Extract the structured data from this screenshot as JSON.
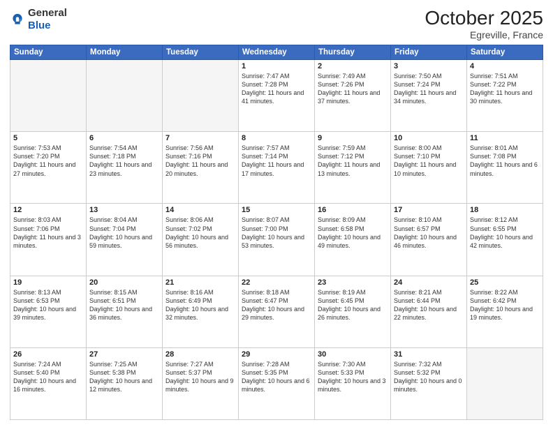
{
  "header": {
    "logo_general": "General",
    "logo_blue": "Blue",
    "month_title": "October 2025",
    "location": "Egreville, France"
  },
  "weekdays": [
    "Sunday",
    "Monday",
    "Tuesday",
    "Wednesday",
    "Thursday",
    "Friday",
    "Saturday"
  ],
  "weeks": [
    [
      {
        "day": "",
        "info": ""
      },
      {
        "day": "",
        "info": ""
      },
      {
        "day": "",
        "info": ""
      },
      {
        "day": "1",
        "info": "Sunrise: 7:47 AM\nSunset: 7:28 PM\nDaylight: 11 hours and 41 minutes."
      },
      {
        "day": "2",
        "info": "Sunrise: 7:49 AM\nSunset: 7:26 PM\nDaylight: 11 hours and 37 minutes."
      },
      {
        "day": "3",
        "info": "Sunrise: 7:50 AM\nSunset: 7:24 PM\nDaylight: 11 hours and 34 minutes."
      },
      {
        "day": "4",
        "info": "Sunrise: 7:51 AM\nSunset: 7:22 PM\nDaylight: 11 hours and 30 minutes."
      }
    ],
    [
      {
        "day": "5",
        "info": "Sunrise: 7:53 AM\nSunset: 7:20 PM\nDaylight: 11 hours and 27 minutes."
      },
      {
        "day": "6",
        "info": "Sunrise: 7:54 AM\nSunset: 7:18 PM\nDaylight: 11 hours and 23 minutes."
      },
      {
        "day": "7",
        "info": "Sunrise: 7:56 AM\nSunset: 7:16 PM\nDaylight: 11 hours and 20 minutes."
      },
      {
        "day": "8",
        "info": "Sunrise: 7:57 AM\nSunset: 7:14 PM\nDaylight: 11 hours and 17 minutes."
      },
      {
        "day": "9",
        "info": "Sunrise: 7:59 AM\nSunset: 7:12 PM\nDaylight: 11 hours and 13 minutes."
      },
      {
        "day": "10",
        "info": "Sunrise: 8:00 AM\nSunset: 7:10 PM\nDaylight: 11 hours and 10 minutes."
      },
      {
        "day": "11",
        "info": "Sunrise: 8:01 AM\nSunset: 7:08 PM\nDaylight: 11 hours and 6 minutes."
      }
    ],
    [
      {
        "day": "12",
        "info": "Sunrise: 8:03 AM\nSunset: 7:06 PM\nDaylight: 11 hours and 3 minutes."
      },
      {
        "day": "13",
        "info": "Sunrise: 8:04 AM\nSunset: 7:04 PM\nDaylight: 10 hours and 59 minutes."
      },
      {
        "day": "14",
        "info": "Sunrise: 8:06 AM\nSunset: 7:02 PM\nDaylight: 10 hours and 56 minutes."
      },
      {
        "day": "15",
        "info": "Sunrise: 8:07 AM\nSunset: 7:00 PM\nDaylight: 10 hours and 53 minutes."
      },
      {
        "day": "16",
        "info": "Sunrise: 8:09 AM\nSunset: 6:58 PM\nDaylight: 10 hours and 49 minutes."
      },
      {
        "day": "17",
        "info": "Sunrise: 8:10 AM\nSunset: 6:57 PM\nDaylight: 10 hours and 46 minutes."
      },
      {
        "day": "18",
        "info": "Sunrise: 8:12 AM\nSunset: 6:55 PM\nDaylight: 10 hours and 42 minutes."
      }
    ],
    [
      {
        "day": "19",
        "info": "Sunrise: 8:13 AM\nSunset: 6:53 PM\nDaylight: 10 hours and 39 minutes."
      },
      {
        "day": "20",
        "info": "Sunrise: 8:15 AM\nSunset: 6:51 PM\nDaylight: 10 hours and 36 minutes."
      },
      {
        "day": "21",
        "info": "Sunrise: 8:16 AM\nSunset: 6:49 PM\nDaylight: 10 hours and 32 minutes."
      },
      {
        "day": "22",
        "info": "Sunrise: 8:18 AM\nSunset: 6:47 PM\nDaylight: 10 hours and 29 minutes."
      },
      {
        "day": "23",
        "info": "Sunrise: 8:19 AM\nSunset: 6:45 PM\nDaylight: 10 hours and 26 minutes."
      },
      {
        "day": "24",
        "info": "Sunrise: 8:21 AM\nSunset: 6:44 PM\nDaylight: 10 hours and 22 minutes."
      },
      {
        "day": "25",
        "info": "Sunrise: 8:22 AM\nSunset: 6:42 PM\nDaylight: 10 hours and 19 minutes."
      }
    ],
    [
      {
        "day": "26",
        "info": "Sunrise: 7:24 AM\nSunset: 5:40 PM\nDaylight: 10 hours and 16 minutes."
      },
      {
        "day": "27",
        "info": "Sunrise: 7:25 AM\nSunset: 5:38 PM\nDaylight: 10 hours and 12 minutes."
      },
      {
        "day": "28",
        "info": "Sunrise: 7:27 AM\nSunset: 5:37 PM\nDaylight: 10 hours and 9 minutes."
      },
      {
        "day": "29",
        "info": "Sunrise: 7:28 AM\nSunset: 5:35 PM\nDaylight: 10 hours and 6 minutes."
      },
      {
        "day": "30",
        "info": "Sunrise: 7:30 AM\nSunset: 5:33 PM\nDaylight: 10 hours and 3 minutes."
      },
      {
        "day": "31",
        "info": "Sunrise: 7:32 AM\nSunset: 5:32 PM\nDaylight: 10 hours and 0 minutes."
      },
      {
        "day": "",
        "info": ""
      }
    ]
  ]
}
